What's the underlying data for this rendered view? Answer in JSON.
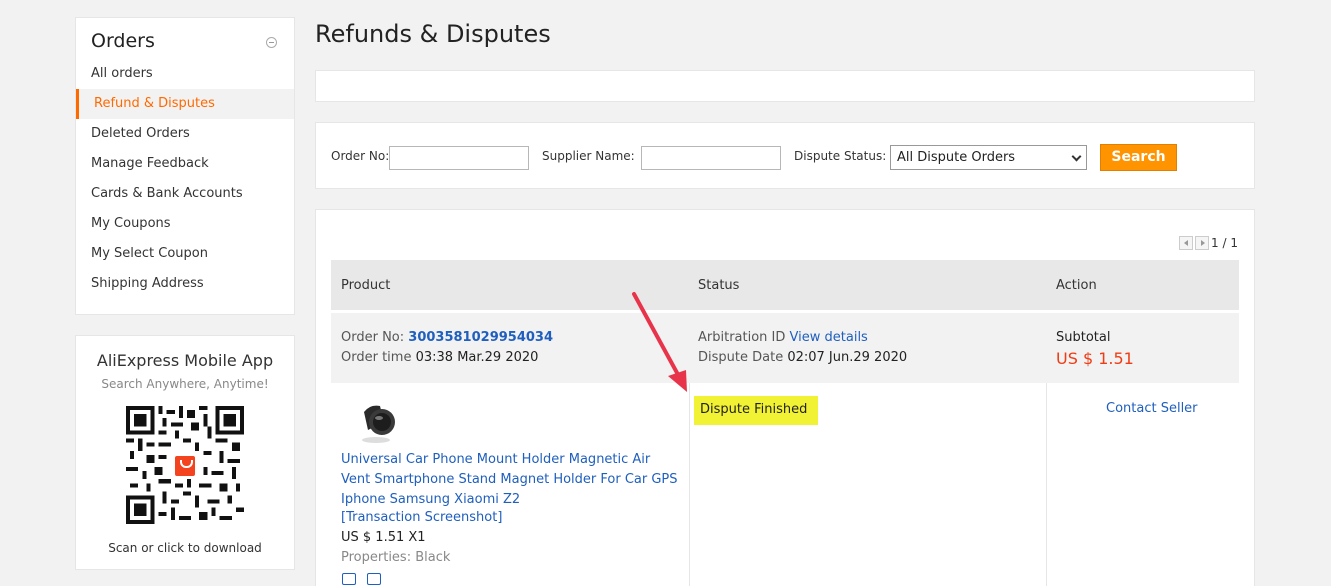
{
  "sidebar": {
    "title": "Orders",
    "items": [
      {
        "label": "All orders"
      },
      {
        "label": "Refund & Disputes"
      },
      {
        "label": "Deleted Orders"
      },
      {
        "label": "Manage Feedback"
      },
      {
        "label": "Cards & Bank Accounts"
      },
      {
        "label": "My Coupons"
      },
      {
        "label": "My Select Coupon"
      },
      {
        "label": "Shipping Address"
      }
    ]
  },
  "app_promo": {
    "title": "AliExpress Mobile App",
    "subtitle": "Search Anywhere, Anytime!",
    "footer": "Scan or click to download"
  },
  "page_title": "Refunds & Disputes",
  "filters": {
    "order_no_label": "Order No:",
    "supplier_label": "Supplier Name:",
    "status_label": "Dispute Status:",
    "status_selected": "All Dispute Orders",
    "search_label": "Search"
  },
  "pager": {
    "text": "1 / 1"
  },
  "table": {
    "headers": [
      "Product",
      "Status",
      "Action"
    ]
  },
  "order": {
    "order_no_label": "Order No:",
    "order_no": "3003581029954034",
    "order_time_label": "Order time",
    "order_time": "03:38 Mar.29 2020",
    "arbitration_label": "Arbitration ID",
    "view_details": "View details",
    "dispute_date_label": "Dispute Date",
    "dispute_date": "02:07 Jun.29 2020",
    "subtotal_label": "Subtotal",
    "subtotal": "US $ 1.51",
    "product_name": "Universal Car Phone Mount Holder Magnetic Air Vent Smartphone Stand Magnet Holder For Car GPS Iphone Samsung Xiaomi Z2",
    "screenshot_link": "[Transaction Screenshot]",
    "unit_price": "US $ 1.51 X1",
    "properties": "Properties: Black",
    "status": "Dispute Finished",
    "contact": "Contact Seller"
  },
  "colors": {
    "accent": "#ff6a00",
    "button": "#ff9400",
    "link": "#1f5fbe",
    "price": "#f03c14",
    "highlight": "#f2f235",
    "annotation_arrow": "#e8344a"
  }
}
